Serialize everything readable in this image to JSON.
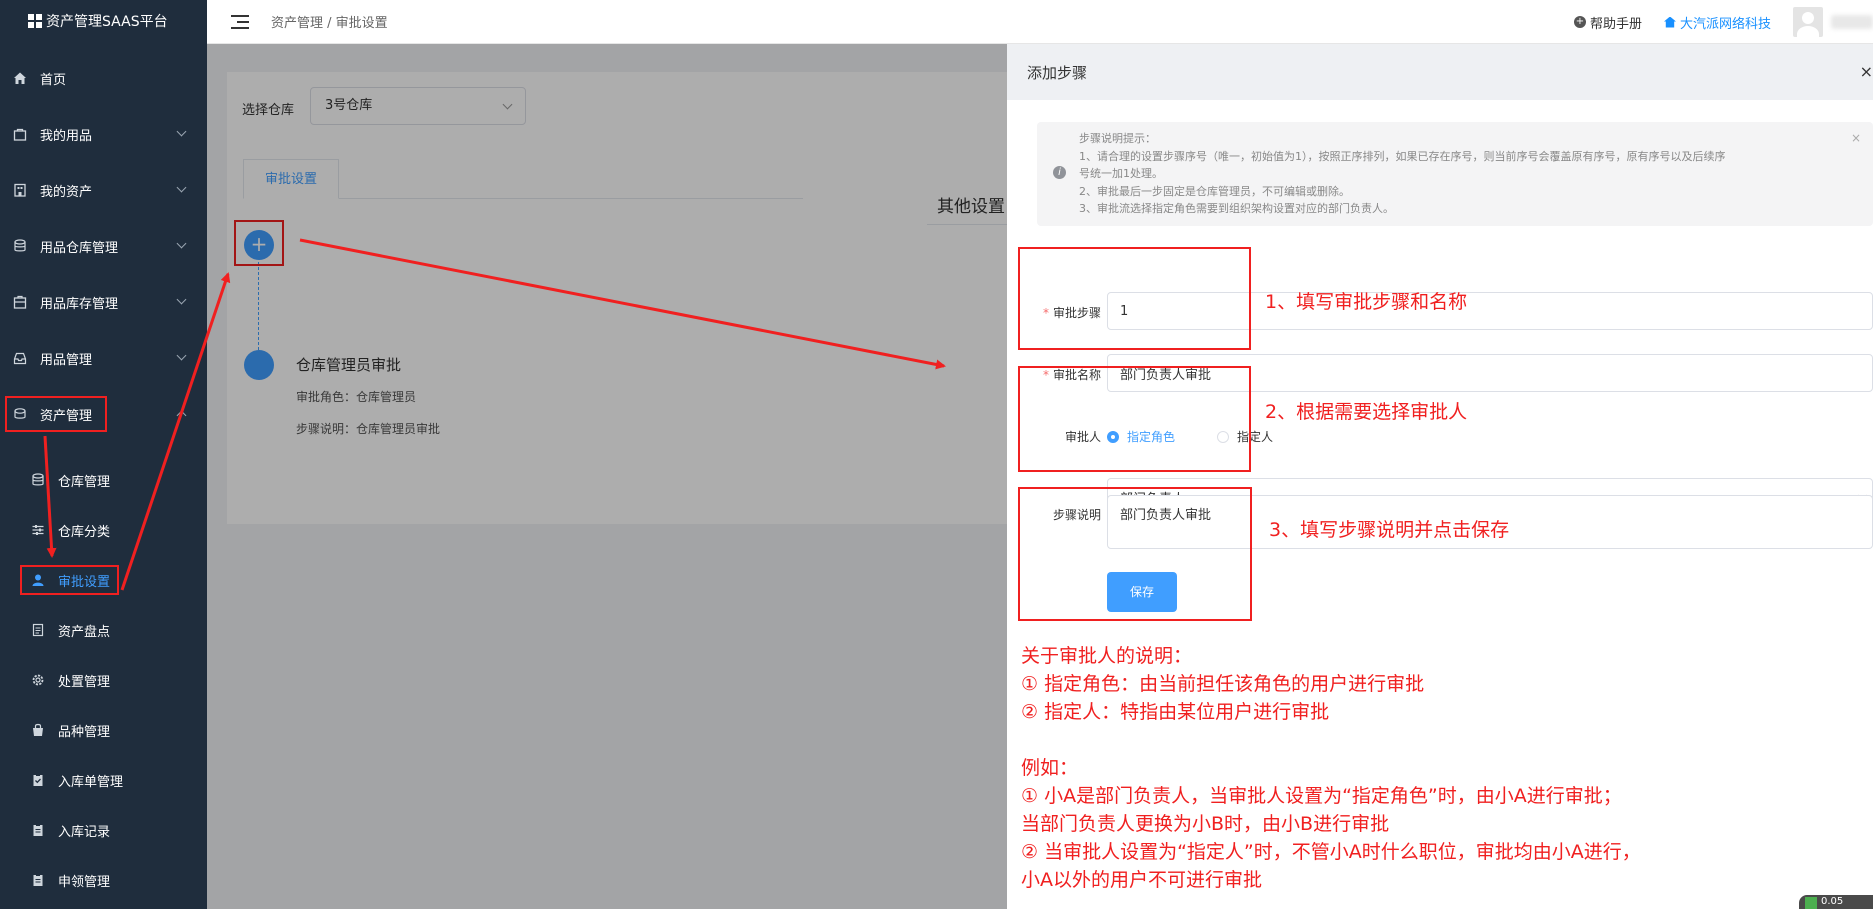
{
  "app": {
    "title": "资产管理SAAS平台",
    "breadcrumb": "资产管理 / 审批设置",
    "help_label": "帮助手册",
    "company_label": "大汽派网络科技"
  },
  "sidebar": {
    "items": [
      {
        "label": "首页",
        "icon": "home-icon"
      },
      {
        "label": "我的用品",
        "icon": "bag-icon"
      },
      {
        "label": "我的资产",
        "icon": "building-icon"
      },
      {
        "label": "用品仓库管理",
        "icon": "database-icon"
      },
      {
        "label": "用品库存管理",
        "icon": "box-icon"
      },
      {
        "label": "用品管理",
        "icon": "inbox-icon"
      },
      {
        "label": "资产管理",
        "icon": "coins-icon"
      }
    ],
    "sub_items": [
      {
        "label": "仓库管理",
        "icon": "database-icon"
      },
      {
        "label": "仓库分类",
        "icon": "sliders-icon"
      },
      {
        "label": "审批设置",
        "icon": "user-icon"
      },
      {
        "label": "资产盘点",
        "icon": "document-icon"
      },
      {
        "label": "处置管理",
        "icon": "gear-icon"
      },
      {
        "label": "品种管理",
        "icon": "bag-icon"
      },
      {
        "label": "入库单管理",
        "icon": "clipboard-check-icon"
      },
      {
        "label": "入库记录",
        "icon": "clipboard-icon"
      },
      {
        "label": "申领管理",
        "icon": "clipboard-icon"
      }
    ]
  },
  "main": {
    "warehouse_label": "选择仓库",
    "warehouse_value": "3号仓库",
    "tab_label": "审批设置",
    "other_settings": "其他设置",
    "node_title": "仓库管理员审批",
    "node_role": "审批角色：仓库管理员",
    "node_desc": "步骤说明：仓库管理员审批"
  },
  "drawer": {
    "title": "添加步骤",
    "alert_lines": [
      "步骤说明提示：",
      "1、请合理的设置步骤序号（唯一，初始值为1），按照正序排列，如果已存在序号，则当前序号会覆盖原有序号，原有序号以及后续序",
      "号统一加1处理。",
      "2、审批最后一步固定是仓库管理员，不可编辑或删除。",
      "3、审批流选择指定角色需要到组织架构设置对应的部门负责人。"
    ],
    "step_label": "审批步骤",
    "step_value": "1",
    "name_label": "审批名称",
    "name_value": "部门负责人审批",
    "approver_label": "审批人",
    "radio_role": "指定角色",
    "radio_person": "指定人",
    "role_value": "部门负责人",
    "desc_label": "步骤说明",
    "desc_value": "部门负责人审批",
    "save_label": "保存"
  },
  "annotations": {
    "a1": "1、填写审批步骤和名称",
    "a2": "2、根据需要选择审批人",
    "a3": "3、填写步骤说明并点击保存",
    "explain": [
      "关于审批人的说明：",
      "① 指定角色：由当前担任该角色的用户进行审批",
      "② 指定人：特指由某位用户进行审批",
      "",
      "例如：",
      "① 小A是部门负责人，当审批人设置为“指定角色”时，由小A进行审批；",
      "当部门负责人更换为小B时，由小B进行审批",
      "② 当审批人设置为“指定人”时，不管小A时什么职位，审批均由小A进行，",
      "小A以外的用户不可进行审批"
    ]
  },
  "colors": {
    "sidebar_bg": "#1f2d3d",
    "accent": "#409eff",
    "annotation_red": "#f02020"
  }
}
